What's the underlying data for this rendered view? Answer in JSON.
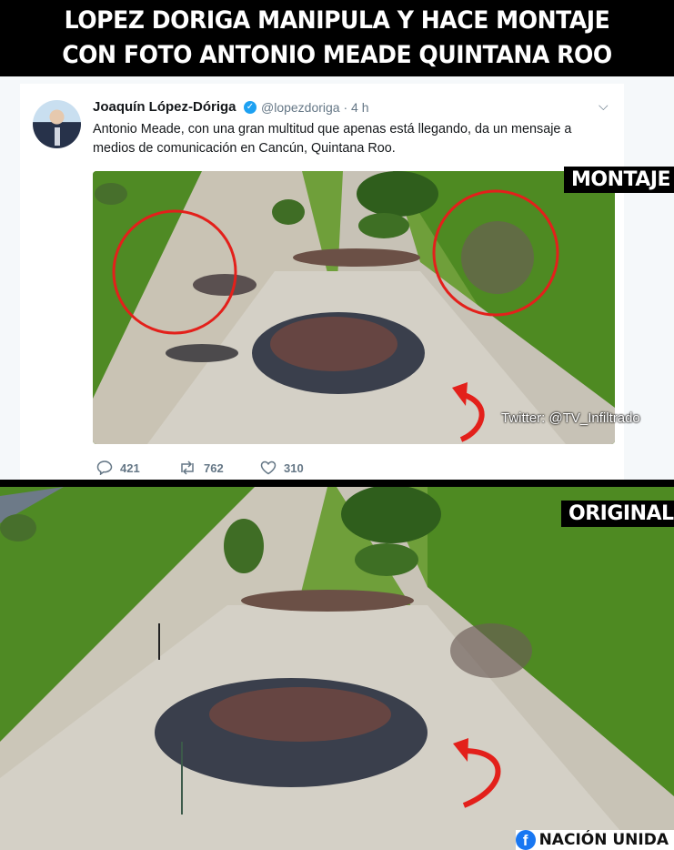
{
  "headline": {
    "line1": "LOPEZ DORIGA MANIPULA Y HACE MONTAJE",
    "line2": "CON FOTO ANTONIO MEADE QUINTANA ROO"
  },
  "tweet": {
    "author_name": "Joaquín López-Dóriga",
    "handle_time": "@lopezdoriga · 4 h",
    "verified_icon": "verified-badge-icon",
    "text": "Antonio Meade, con una gran multitud que apenas está llegando, da un mensaje a medios de comunicación en Cancún, Quintana Roo.",
    "replies": "421",
    "retweets": "762",
    "likes": "310"
  },
  "labels": {
    "montaje": "MONTAJE",
    "original": "ORIGINAL",
    "twitter_credit": "Twitter: @TV_Infiltrado"
  },
  "watermark": {
    "brand": "NACIÓN UNIDA",
    "icon": "facebook-icon"
  },
  "colors": {
    "accent_circle": "#e3201b",
    "arrow": "#e3201b",
    "twitter_blue": "#1da1f2"
  }
}
